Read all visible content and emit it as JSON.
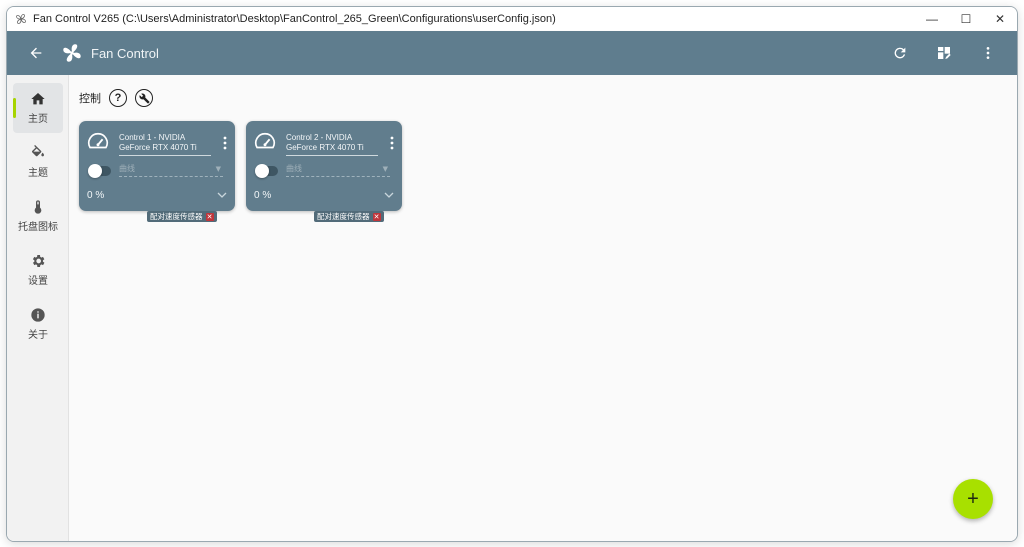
{
  "window": {
    "title": "Fan Control V265 (C:\\Users\\Administrator\\Desktop\\FanControl_265_Green\\Configurations\\userConfig.json)",
    "controls": {
      "minimize": "—",
      "maximize": "☐",
      "close": "✕"
    }
  },
  "appbar": {
    "title": "Fan Control",
    "icons": [
      "back-arrow-icon",
      "fan-logo-icon",
      "refresh-icon",
      "layout-edit-icon",
      "more-vert-icon"
    ]
  },
  "sidebar": {
    "items": [
      {
        "label": "主页",
        "icon": "home-icon",
        "active": true
      },
      {
        "label": "主题",
        "icon": "paint-bucket-icon",
        "active": false
      },
      {
        "label": "托盘图标",
        "icon": "thermometer-icon",
        "active": false
      },
      {
        "label": "设置",
        "icon": "gear-icon",
        "active": false
      },
      {
        "label": "关于",
        "icon": "info-icon",
        "active": false
      }
    ]
  },
  "section": {
    "title": "控制",
    "help_label": "?"
  },
  "cards": [
    {
      "name": "Control 1 - NVIDIA GeForce RTX 4070 Ti",
      "curve_placeholder": "曲线",
      "percent": "0 %",
      "pair_badge": "配对速度传感器",
      "enabled": false
    },
    {
      "name": "Control 2 - NVIDIA GeForce RTX 4070 Ti",
      "curve_placeholder": "曲线",
      "percent": "0 %",
      "pair_badge": "配对速度传感器",
      "enabled": false
    }
  ],
  "fab": {
    "label": "+"
  },
  "colors": {
    "appbar": "#5f7d8e",
    "card": "#617d8d",
    "accent": "#a8e000",
    "badge_close": "#c0353b"
  }
}
